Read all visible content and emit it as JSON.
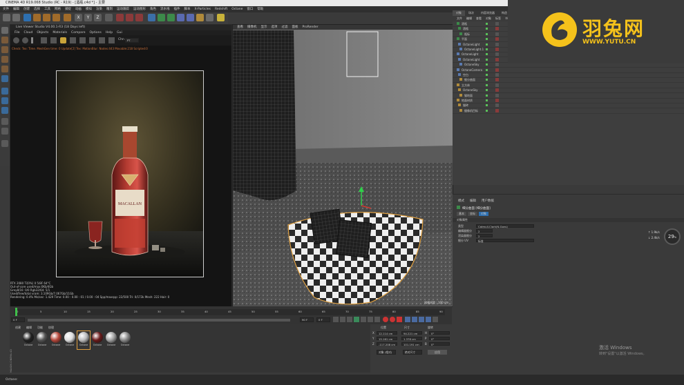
{
  "app_title": "CINEMA 4D R19.068 Studio (RC - R19) - [酒瓶.c4d *] - 主要",
  "main_menu": [
    "文件",
    "编辑",
    "创建",
    "选择",
    "工具",
    "网格",
    "捕捉",
    "动画",
    "模拟",
    "渲染",
    "雕刻",
    "运动跟踪",
    "运动图形",
    "角色",
    "流水线",
    "插件",
    "脚本",
    "X-Particles",
    "Redshift",
    "Octane",
    "窗口",
    "帮助"
  ],
  "live_viewer": {
    "title": "Live Viewer Studio V4.00.1-R3 (18 Days left)",
    "menu": [
      "File",
      "Cloud",
      "Objects",
      "Materials",
      "Compare",
      "Options",
      "Help",
      "Gui"
    ],
    "chn_label": "Chn",
    "chn_value": "PT",
    "status_line": "Check: Tex: Time. MeshGen time: 0  Update[2] Tex: MotionBlur: Nodes:443 Movable:218 Scripted:0",
    "bottle_label": "MACALLAN",
    "stats": [
      "RTX 2080 Ti[0%] 0      5/8F    64°C",
      "Out-of-core used/max:0Kb/4Gb",
      "Grey8/16: 0/0            Rgb32/64: 5/1",
      "Used/free/total vram: 3.109Gb/7.067Gb/11Gb"
    ],
    "render_stats": {
      "rendering": "Rendering: 0.4%",
      "ms": "Ms/sec: 1.429",
      "time": "Time: 0.00 : 0.00 : 01 / 0.00 : 04",
      "spp": "Spp/maxspp: 22/500",
      "tri": "Tri: 0/173k",
      "mesh": "Mesh: 222",
      "hair": "Hair: 0"
    }
  },
  "viewport": {
    "menu": [
      "查看",
      "摄像机",
      "显示",
      "选项",
      "过滤",
      "面板",
      "ProRender"
    ],
    "grid_label": "网格间距 : 100 cm"
  },
  "object_manager": {
    "tabs": [
      "对象",
      "场次",
      "内容浏览器",
      "构造"
    ],
    "menu": [
      "文件",
      "编辑",
      "查看",
      "对象",
      "标签",
      "书签"
    ],
    "objects": [
      "酒瓶",
      "酒瓶",
      "瓶标",
      "平面",
      "OctaneLight",
      "OctaneLight.1",
      "OctaneLight",
      "OctaneLight",
      "OctaneSky",
      "OctaneCamera",
      "空白",
      "细分曲面",
      "立方体",
      "OctaneSky",
      "猫地面",
      "地面材质",
      "猫砖",
      "摄像机目标"
    ]
  },
  "attributes": {
    "menu": [
      "模式",
      "编辑",
      "用户数据"
    ],
    "object_title": "细分曲面 [细分曲面]",
    "tabs": [
      "基本",
      "坐标",
      "对象"
    ],
    "section": "对象属性",
    "rows": [
      {
        "label": "类型",
        "value": "Catmull-Clark(N-Gons)"
      },
      {
        "label": "编辑器细分",
        "value": "2"
      },
      {
        "label": "渲染器细分",
        "value": "2"
      },
      {
        "label": "细分 UV",
        "value": "标准"
      }
    ],
    "gauge_value": "29",
    "gauge_unit": "%",
    "net_up": "1.9k/s",
    "net_down": "2.4k/s"
  },
  "timeline": {
    "ticks": [
      "0",
      "5",
      "10",
      "15",
      "20",
      "25",
      "30",
      "35",
      "40",
      "45",
      "50",
      "55",
      "60",
      "65",
      "70",
      "75",
      "80",
      "85",
      "90"
    ],
    "start": "0 F",
    "end": "90 F",
    "current": "0 F"
  },
  "materials": {
    "menu": [
      "创建",
      "编辑",
      "功能",
      "纹理"
    ],
    "items": [
      "Octane",
      "Octane",
      "Octane",
      "Octane",
      "Octane",
      "Octane",
      "Octane",
      "Octane"
    ]
  },
  "coordinates": {
    "headers": [
      "位置",
      "尺寸",
      "旋转"
    ],
    "rows": [
      {
        "axis": "X",
        "pos": "12.114 cm",
        "size": "94.221 cm",
        "rot_label": "H",
        "rot": "0°"
      },
      {
        "axis": "Y",
        "pos": "15.161 cm",
        "size": "1.378 cm",
        "rot_label": "P",
        "rot": "0°"
      },
      {
        "axis": "Z",
        "pos": "-117.208 cm",
        "size": "101.191 cm",
        "rot_label": "B",
        "rot": "0°"
      }
    ],
    "mode_object": "对象 (相对)",
    "mode_size": "绝对尺寸",
    "apply": "应用"
  },
  "side_labels": [
    "MAXON",
    "CINEMA 4D"
  ],
  "watermark": {
    "brand": "羽兔网",
    "url": "WWW.YUTU.CN"
  },
  "windows_watermark": {
    "line1": "激活 Windows",
    "line2": "转到\"设置\"以激活 Windows。"
  },
  "status_bar": "Octane:"
}
